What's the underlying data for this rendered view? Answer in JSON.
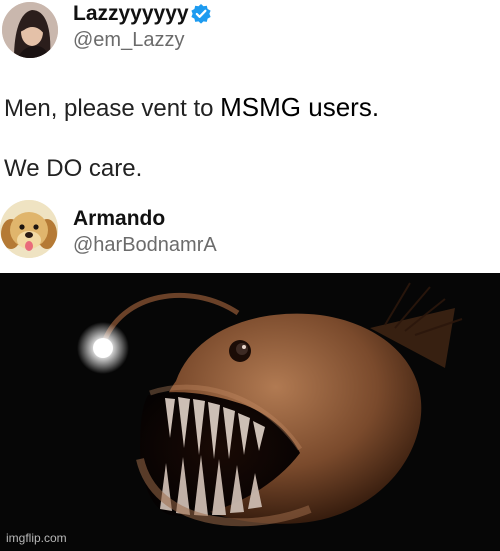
{
  "tweet": {
    "author": {
      "name": "Lazzyyyyyy",
      "handle": "@em_Lazzy",
      "verified_color": "#1d9bf0"
    },
    "text_prefix": "Men, please vent to",
    "text_overlay": "MSMG users.",
    "text_line2": "We DO care."
  },
  "reply": {
    "name": "Armando",
    "handle": "@harBodnamrA"
  },
  "image": {
    "subject": "anglerfish",
    "glow_color": "#ffffff",
    "body_color": "#8a5b3a"
  },
  "watermark": "imgflip.com"
}
